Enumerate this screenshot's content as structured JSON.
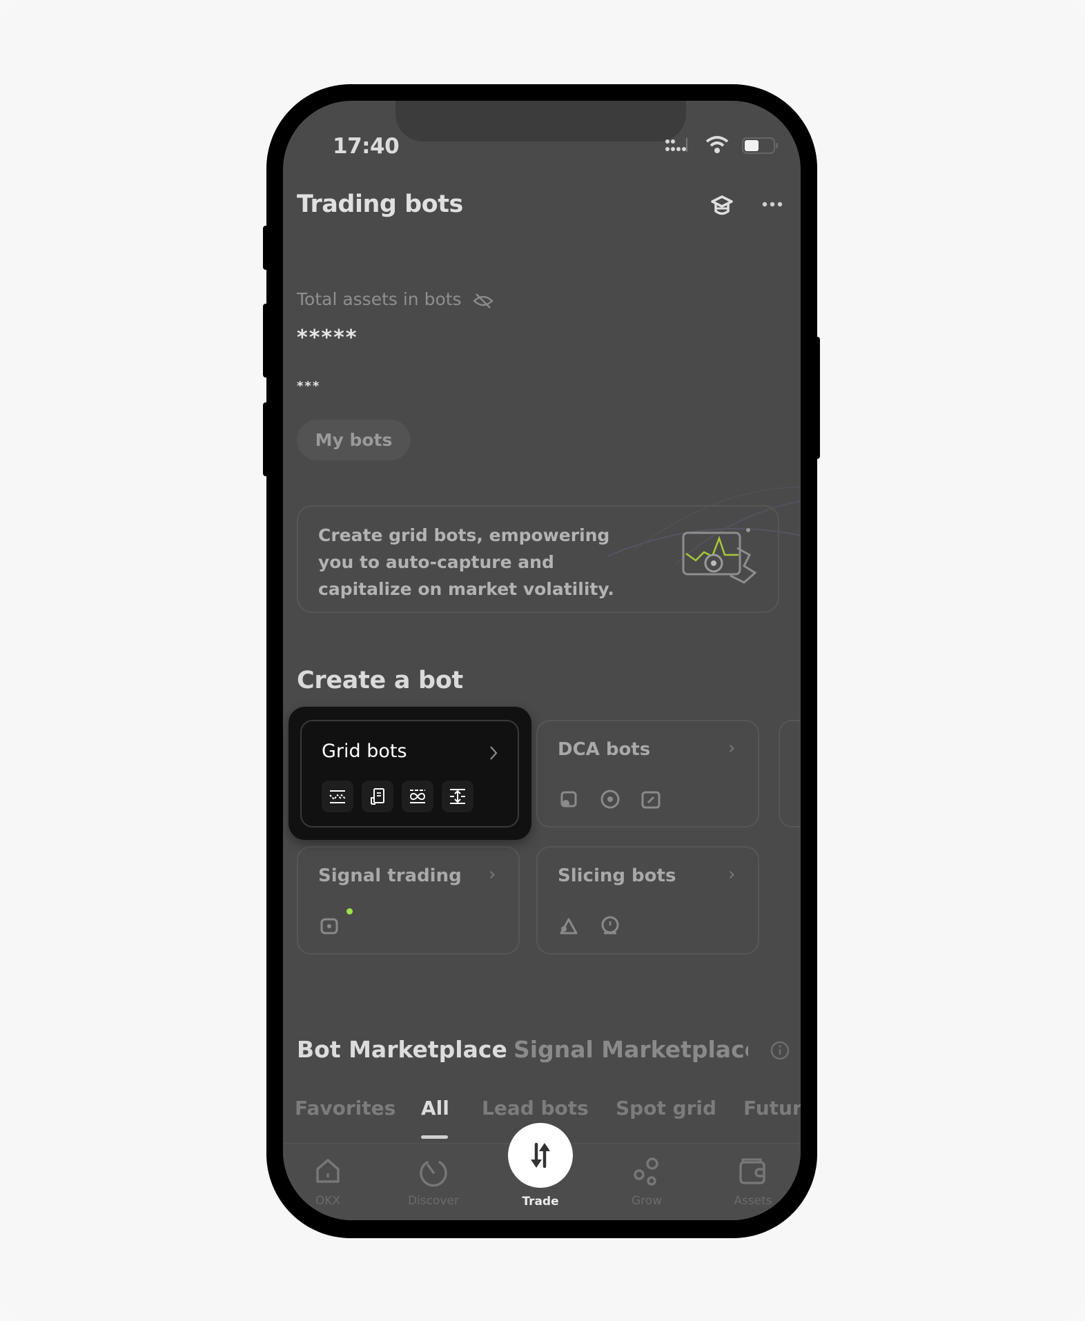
{
  "status_bar": {
    "time": "17:40",
    "icons": [
      "signal-icon",
      "wifi-icon",
      "battery-icon"
    ]
  },
  "header": {
    "title": "Trading bots",
    "icons": [
      "graduation-cap-icon",
      "more-icon"
    ]
  },
  "assets": {
    "label": "Total assets in bots",
    "label_icon": "eye-off-icon",
    "value_masked": "*****",
    "sub_value_masked": "***"
  },
  "my_bots_button": "My bots",
  "promo": {
    "text": "Create grid bots, empowering you to auto-capture and capitalize on market volatility.",
    "illustration": "grid-chart-illustration",
    "accent_color": "#a6c83a"
  },
  "create_section": {
    "title": "Create a bot",
    "cards": [
      {
        "title": "Grid bots",
        "highlighted": true,
        "icons": [
          "spot-grid-icon",
          "futures-grid-icon",
          "infinity-grid-icon",
          "moon-grid-icon"
        ]
      },
      {
        "title": "DCA bots",
        "highlighted": false,
        "icons": [
          "spot-dca-icon",
          "futures-dca-icon",
          "recurring-buy-icon"
        ]
      },
      {
        "title": "Signal trading",
        "highlighted": false,
        "icons": [
          "signal-bot-icon"
        ],
        "badge_color": "#9be34a"
      },
      {
        "title": "Slicing bots",
        "highlighted": false,
        "icons": [
          "iceberg-icon",
          "twap-icon"
        ]
      }
    ]
  },
  "marketplace": {
    "tabs": [
      {
        "label": "Bot Marketplace",
        "active": true
      },
      {
        "label": "Signal Marketplace",
        "active": false
      }
    ],
    "info_icon": "info-icon",
    "filters": [
      {
        "label": "Favorites",
        "active": false
      },
      {
        "label": "All",
        "active": true
      },
      {
        "label": "Lead bots",
        "active": false
      },
      {
        "label": "Spot grid",
        "active": false
      },
      {
        "label": "Futures grid",
        "active": false
      }
    ],
    "filter_truncated_label": "Futur"
  },
  "bottom_nav": [
    {
      "label": "OKX",
      "icon": "home-icon",
      "active": false
    },
    {
      "label": "Discover",
      "icon": "discover-icon",
      "active": false
    },
    {
      "label": "Trade",
      "icon": "trade-icon",
      "active": true
    },
    {
      "label": "Grow",
      "icon": "grow-icon",
      "active": false
    },
    {
      "label": "Assets",
      "icon": "wallet-icon",
      "active": false
    }
  ]
}
